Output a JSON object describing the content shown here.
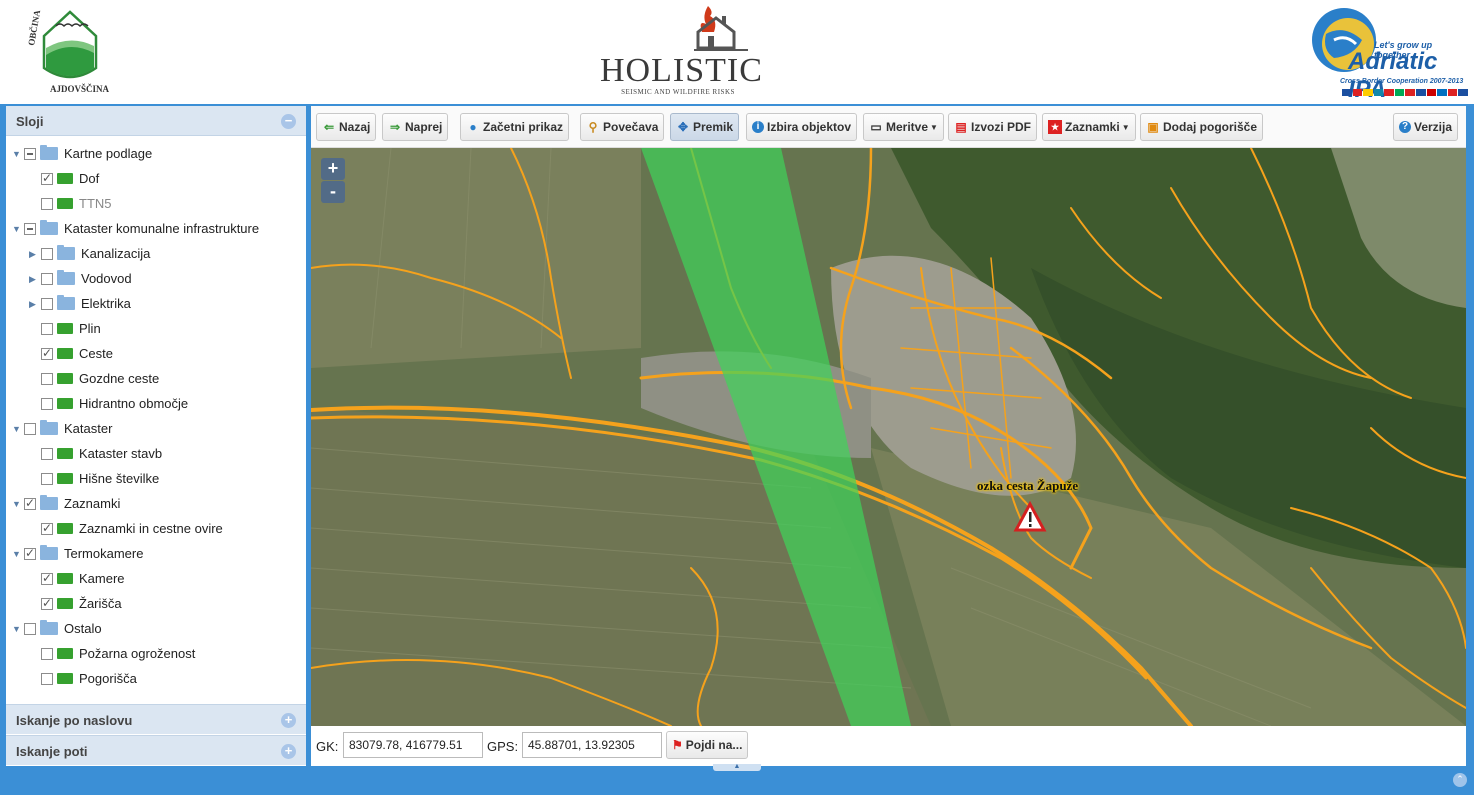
{
  "header": {
    "left_logo": {
      "name": "Občina Ajdovščina",
      "text": "OBČINA AJDOVŠČINA"
    },
    "center_logo": {
      "title": "HOLISTIC",
      "subtitle": "SEISMIC AND WILDFIRE RISKS"
    },
    "right_logo": {
      "tagline": "Let's grow up together",
      "title": "Adriatic IPA",
      "subtitle": "Cross Border Cooperation 2007-2013"
    }
  },
  "sidebar": {
    "layers_title": "Sloji",
    "tree": [
      {
        "label": "Kartne podlage",
        "level": 0,
        "type": "folder",
        "check": "partial",
        "expanded": true
      },
      {
        "label": "Dof",
        "level": 1,
        "type": "layer",
        "check": "checked"
      },
      {
        "label": "TTN5",
        "level": 1,
        "type": "layer",
        "check": "none",
        "muted": true
      },
      {
        "label": "Kataster komunalne infrastrukture",
        "level": 0,
        "type": "folder",
        "check": "partial",
        "expanded": true
      },
      {
        "label": "Kanalizacija",
        "level": 1,
        "type": "folder",
        "check": "none",
        "expanded": false
      },
      {
        "label": "Vodovod",
        "level": 1,
        "type": "folder",
        "check": "none",
        "expanded": false
      },
      {
        "label": "Elektrika",
        "level": 1,
        "type": "folder",
        "check": "none",
        "expanded": false
      },
      {
        "label": "Plin",
        "level": 1,
        "type": "layer",
        "check": "none"
      },
      {
        "label": "Ceste",
        "level": 1,
        "type": "layer",
        "check": "checked"
      },
      {
        "label": "Gozdne ceste",
        "level": 1,
        "type": "layer",
        "check": "none"
      },
      {
        "label": "Hidrantno območje",
        "level": 1,
        "type": "layer",
        "check": "none"
      },
      {
        "label": "Kataster",
        "level": 0,
        "type": "folder",
        "check": "none",
        "expanded": true
      },
      {
        "label": "Kataster stavb",
        "level": 1,
        "type": "layer",
        "check": "none"
      },
      {
        "label": "Hišne številke",
        "level": 1,
        "type": "layer",
        "check": "none"
      },
      {
        "label": "Zaznamki",
        "level": 0,
        "type": "folder",
        "check": "checked",
        "expanded": true
      },
      {
        "label": "Zaznamki in cestne ovire",
        "level": 1,
        "type": "layer",
        "check": "checked"
      },
      {
        "label": "Termokamere",
        "level": 0,
        "type": "folder",
        "check": "checked",
        "expanded": true
      },
      {
        "label": "Kamere",
        "level": 1,
        "type": "layer",
        "check": "checked"
      },
      {
        "label": "Žarišča",
        "level": 1,
        "type": "layer",
        "check": "checked"
      },
      {
        "label": "Ostalo",
        "level": 0,
        "type": "folder",
        "check": "none",
        "expanded": true
      },
      {
        "label": "Požarna ogroženost",
        "level": 1,
        "type": "layer",
        "check": "none"
      },
      {
        "label": "Pogorišča",
        "level": 1,
        "type": "layer",
        "check": "none"
      }
    ],
    "address_search_title": "Iskanje po naslovu",
    "route_search_title": "Iskanje poti"
  },
  "toolbar": {
    "back": "Nazaj",
    "forward": "Naprej",
    "initial_view": "Začetni prikaz",
    "zoom": "Povečava",
    "pan": "Premik",
    "select_objects": "Izbira objektov",
    "measurements": "Meritve",
    "export_pdf": "Izvozi PDF",
    "bookmarks": "Zaznamki",
    "add_burned_area": "Dodaj pogorišče",
    "version": "Verzija"
  },
  "map": {
    "zoom_in": "+",
    "zoom_out": "-",
    "marker_label": "ozka cesta Žapuže",
    "colors": {
      "roads": "#f5a21c",
      "camera_view": "#3fd45a",
      "terrain": "#5f6f4a"
    }
  },
  "coordbar": {
    "gk_label": "GK:",
    "gk_value": "83079.78, 416779.51",
    "gps_label": "GPS:",
    "gps_value": "45.88701, 13.92305",
    "goto_label": "Pojdi na..."
  }
}
